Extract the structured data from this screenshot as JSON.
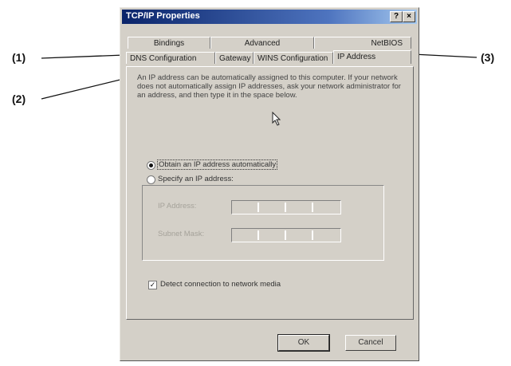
{
  "callouts": {
    "c1": "(1)",
    "c2": "(2)",
    "c3": "(3)"
  },
  "dialog": {
    "title": "TCP/IP Properties",
    "help_btn": "?",
    "close_btn": "×",
    "tabs_back": [
      "Bindings",
      "Advanced",
      "NetBIOS"
    ],
    "tabs_front": [
      "DNS Configuration",
      "Gateway",
      "WINS Configuration",
      "IP Address"
    ],
    "active_tab": "IP Address",
    "description": "An IP address can be automatically assigned to this computer. If your network does not automatically assign IP addresses, ask your network administrator for an address, and then type it in the space below.",
    "option_auto": "Obtain an IP address automatically",
    "option_specify": "Specify an IP address:",
    "selected_option": "auto",
    "ip_address_label": "IP Address:",
    "subnet_mask_label": "Subnet Mask:",
    "detect_label": "Detect connection to network media",
    "detect_checked": true,
    "check_mark": "✓",
    "ok_label": "OK",
    "cancel_label": "Cancel"
  }
}
